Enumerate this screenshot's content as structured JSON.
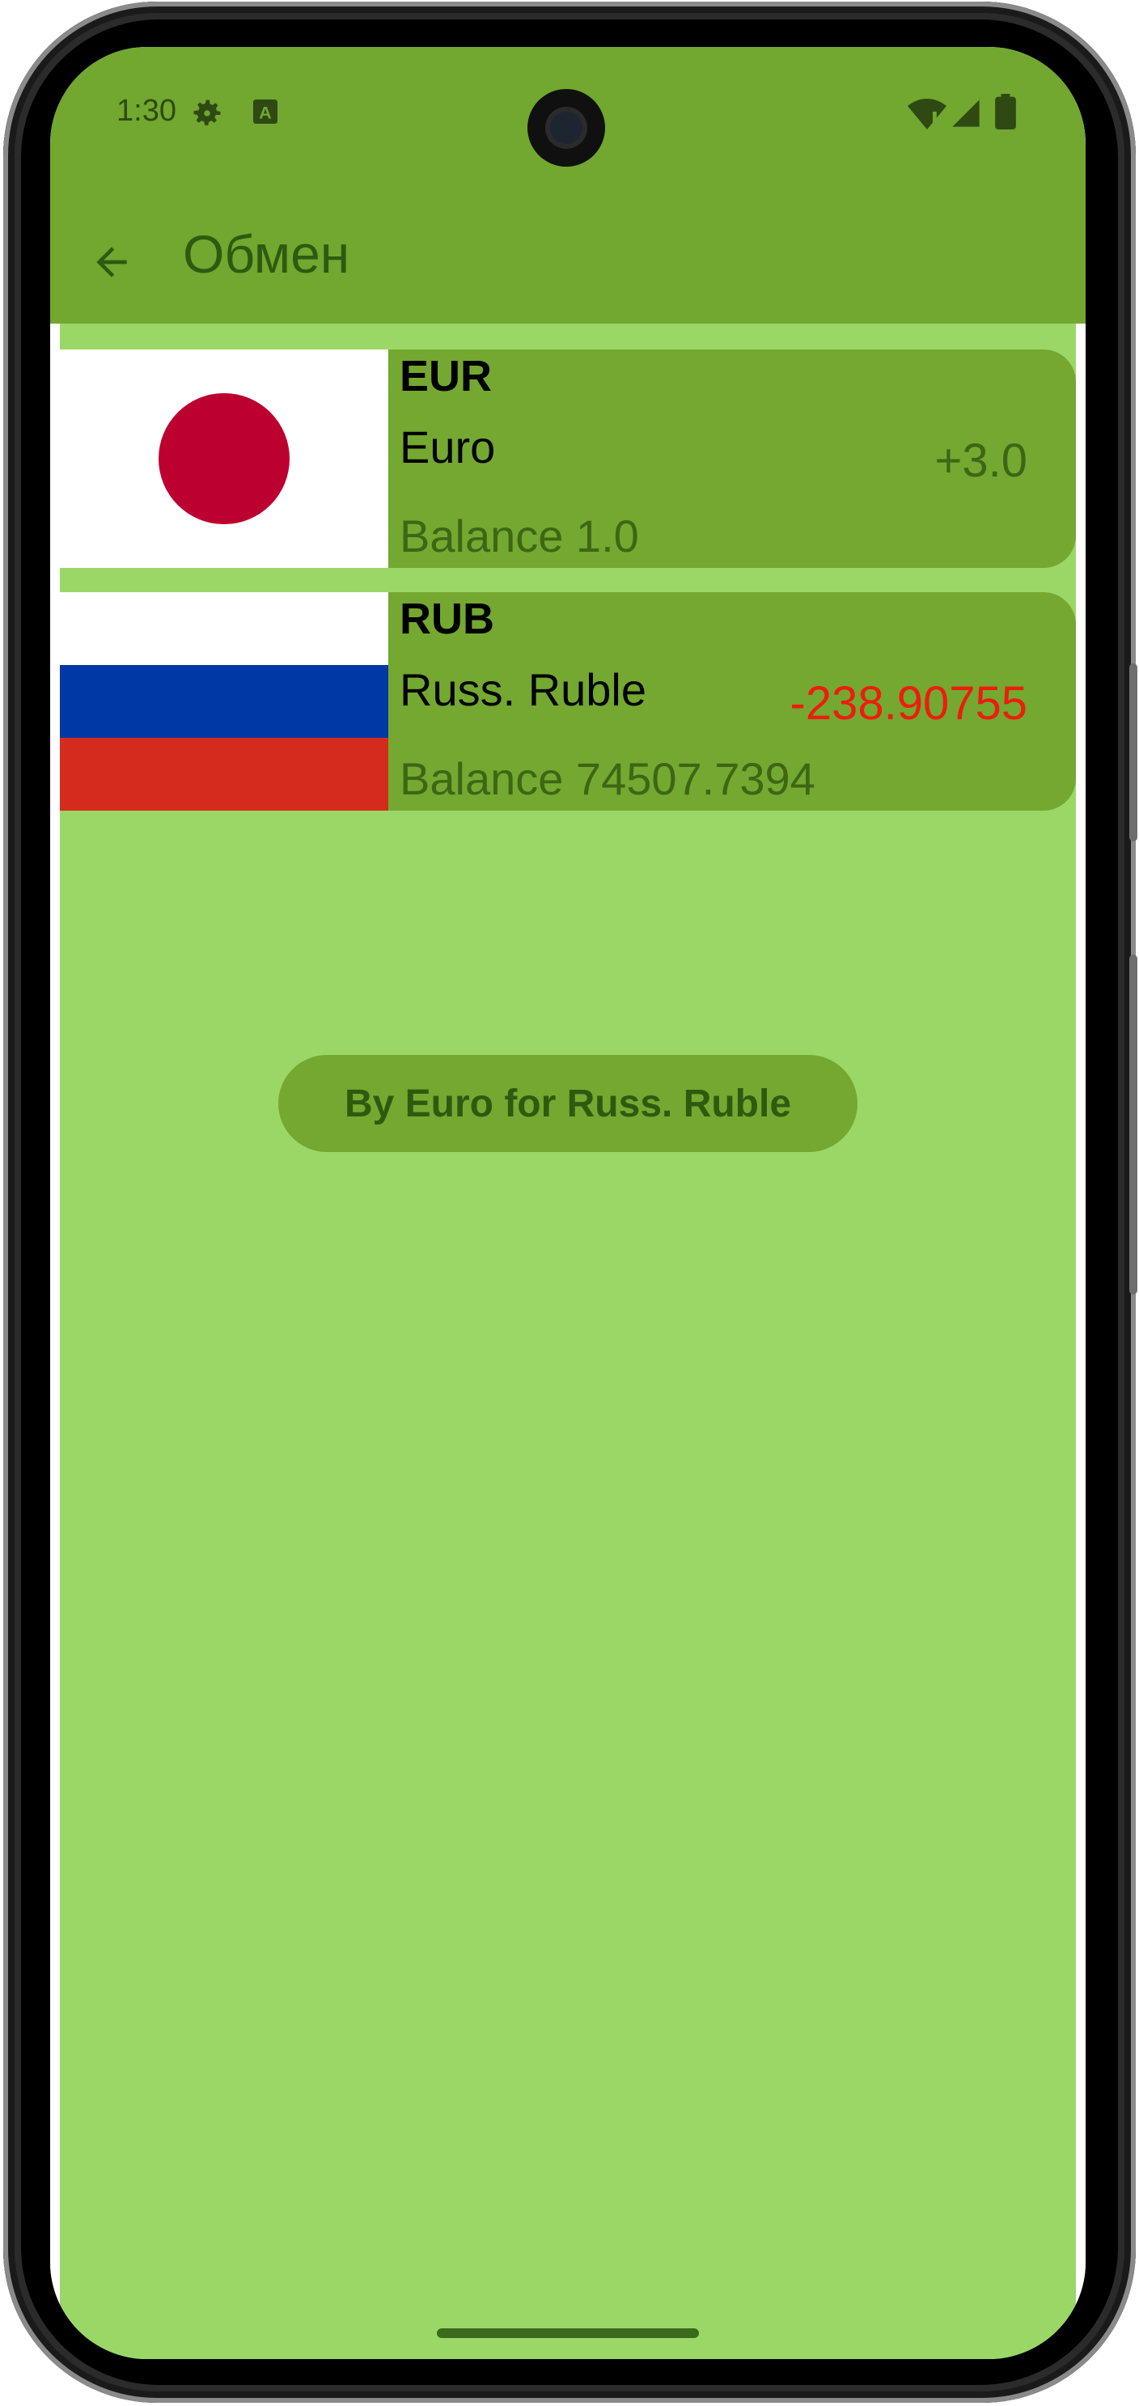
{
  "status_bar": {
    "time": "1:30",
    "icons": [
      "settings-icon",
      "text-icon",
      "wifi-icon",
      "signal-icon",
      "battery-icon"
    ]
  },
  "app_bar": {
    "title": "Обмен",
    "back_icon": "arrow-back-icon"
  },
  "currencies": [
    {
      "code": "EUR",
      "name": "Euro",
      "balance_text": "Balance 1.0",
      "delta": "+3.0",
      "delta_color": "#3d6615",
      "flag": "japan-flag-icon"
    },
    {
      "code": "RUB",
      "name": "Russ. Ruble",
      "balance_text": "Balance 74507.7394",
      "delta": "-238.90755",
      "delta_color": "#ee1c0f",
      "flag": "russia-flag-icon"
    }
  ],
  "action": {
    "label": "By Euro for Russ. Ruble"
  },
  "colors": {
    "app_bar": "#72a730",
    "background": "#9bd767",
    "card": "#74a830",
    "negative": "#ee1c0f"
  }
}
